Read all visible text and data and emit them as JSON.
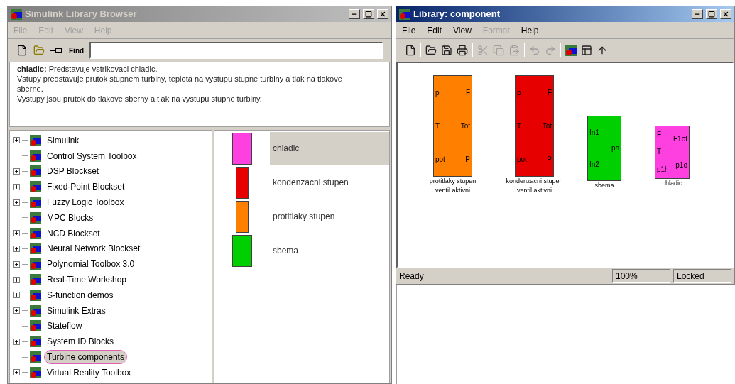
{
  "library_browser": {
    "title": "Simulink Library Browser",
    "active": false,
    "menu": [
      {
        "label": "File"
      },
      {
        "label": "Edit"
      },
      {
        "label": "View"
      },
      {
        "label": "Help"
      }
    ],
    "toolbar": {
      "find_label": "Find"
    },
    "description": [
      "**chladic:** Predstavuje vstrikovaci chladic.",
      "Vstupy predstavuje prutok stupnem turbiny, teplota na vystupu stupne turbiny a tlak na tlakove sberne.",
      "Vystupy jsou prutok do tlakove sberny a tlak na vystupu stupne turbiny."
    ],
    "tree": [
      {
        "label": "Simulink",
        "expandable": true,
        "selected": false
      },
      {
        "label": "Control System Toolbox",
        "expandable": false,
        "selected": false
      },
      {
        "label": "DSP Blockset",
        "expandable": true,
        "selected": false
      },
      {
        "label": "Fixed-Point Blockset",
        "expandable": true,
        "selected": false
      },
      {
        "label": "Fuzzy Logic Toolbox",
        "expandable": true,
        "selected": false
      },
      {
        "label": "MPC Blocks",
        "expandable": false,
        "selected": false
      },
      {
        "label": "NCD Blockset",
        "expandable": true,
        "selected": false
      },
      {
        "label": "Neural Network Blockset",
        "expandable": true,
        "selected": false
      },
      {
        "label": "Polynomial Toolbox 3.0",
        "expandable": true,
        "selected": false
      },
      {
        "label": "Real-Time Workshop",
        "expandable": true,
        "selected": false
      },
      {
        "label": "S-function demos",
        "expandable": true,
        "selected": false
      },
      {
        "label": "Simulink Extras",
        "expandable": true,
        "selected": false
      },
      {
        "label": "Stateflow",
        "expandable": false,
        "selected": false
      },
      {
        "label": "System ID Blocks",
        "expandable": true,
        "selected": false
      },
      {
        "label": "Turbine components",
        "expandable": false,
        "selected": true
      },
      {
        "label": "Virtual Reality Toolbox",
        "expandable": true,
        "selected": false
      }
    ],
    "blocks": [
      {
        "label": "chladic",
        "color": "#ff40e0",
        "wide": true,
        "selected": true
      },
      {
        "label": "kondenzacni stupen",
        "color": "#e60000",
        "wide": false,
        "selected": false
      },
      {
        "label": "protitlaky stupen",
        "color": "#ff8000",
        "wide": false,
        "selected": false
      },
      {
        "label": "sbema",
        "color": "#00d000",
        "wide": true,
        "selected": false
      }
    ]
  },
  "library_window": {
    "title": "Library: component",
    "active": true,
    "menu": [
      {
        "label": "File",
        "disabled": false
      },
      {
        "label": "Edit",
        "disabled": false
      },
      {
        "label": "View",
        "disabled": false
      },
      {
        "label": "Format",
        "disabled": true
      },
      {
        "label": "Help",
        "disabled": false
      }
    ],
    "toolbar": [
      {
        "kind": "new",
        "disabled": false
      },
      {
        "kind": "sep"
      },
      {
        "kind": "open",
        "disabled": false
      },
      {
        "kind": "save",
        "disabled": false
      },
      {
        "kind": "print",
        "disabled": false
      },
      {
        "kind": "sep"
      },
      {
        "kind": "cut",
        "disabled": true
      },
      {
        "kind": "copy",
        "disabled": true
      },
      {
        "kind": "paste",
        "disabled": true
      },
      {
        "kind": "sep"
      },
      {
        "kind": "undo",
        "disabled": true
      },
      {
        "kind": "redo",
        "disabled": true
      },
      {
        "kind": "sep"
      },
      {
        "kind": "library",
        "disabled": false
      },
      {
        "kind": "browser",
        "disabled": false
      },
      {
        "kind": "up",
        "disabled": false
      }
    ],
    "canvas_blocks": [
      {
        "color": "#ff8000",
        "inputs": [
          "p",
          "T",
          "pot"
        ],
        "outputs": [
          "F",
          "Tot",
          "P"
        ],
        "caption": [
          "protitlaky stupen",
          "ventil aktivni"
        ]
      },
      {
        "color": "#e60000",
        "inputs": [
          "p",
          "T",
          "pot"
        ],
        "outputs": [
          "F",
          "Tot",
          "P"
        ],
        "caption": [
          "kondenzacni stupen",
          "ventil aktivni"
        ]
      },
      {
        "color": "#00d000",
        "inputs": [
          "In1",
          "In2"
        ],
        "outputs": [
          "ph"
        ],
        "caption": [
          "sbema"
        ]
      },
      {
        "color": "#ff40e0",
        "inputs": [
          "F",
          "T",
          "p1h"
        ],
        "outputs": [
          "F1ot",
          "p1o"
        ],
        "caption": [
          "chladic"
        ]
      }
    ],
    "status": {
      "message": "Ready",
      "zoom": "100%",
      "lock": "Locked"
    }
  }
}
